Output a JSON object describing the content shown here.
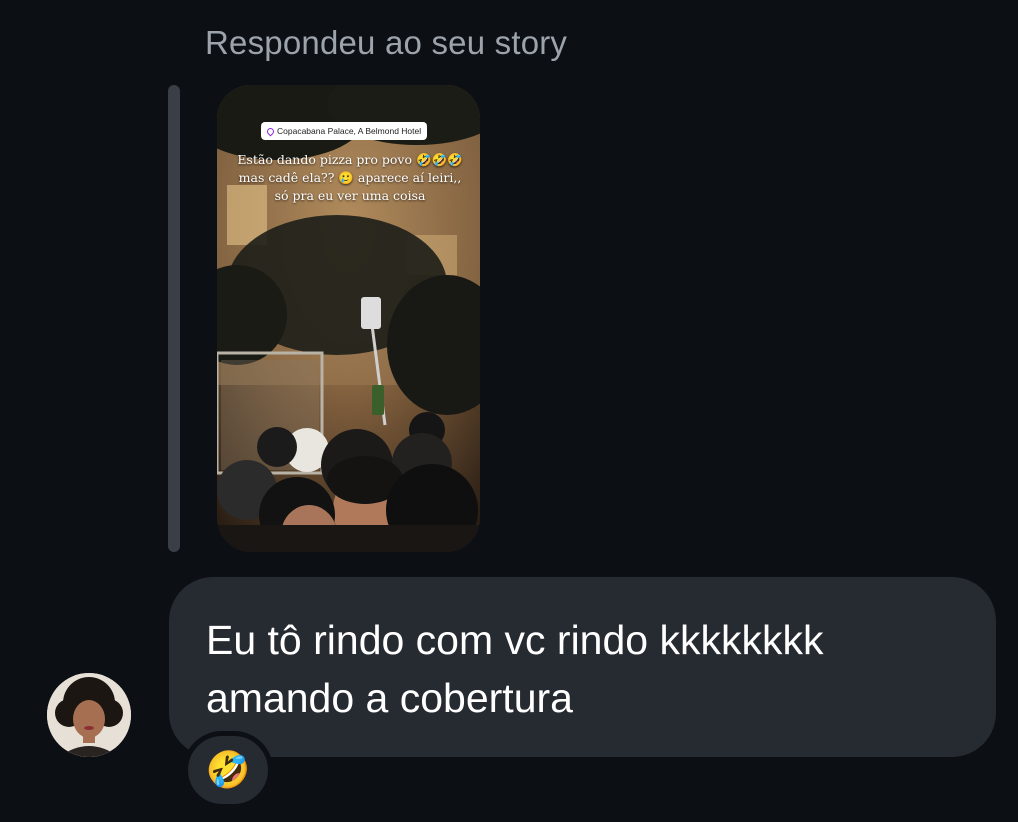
{
  "reply": {
    "caption": "Respondeu ao seu story"
  },
  "story": {
    "location": "Copacabana Palace, A Belmond Hotel",
    "caption": "Estão dando pizza pro povo 🤣🤣🤣 mas cadê ela?? 🥲 aparece aí leiri,, só pra eu ver uma coisa"
  },
  "message": {
    "text": "Eu tô rindo com vc rindo kkkkkkkk amando a cobertura"
  },
  "reaction": {
    "emoji": "🤣"
  },
  "colors": {
    "background": "#0c0f14",
    "bubble": "#262a31",
    "caption_gray": "#9da3ab",
    "quote_bar": "#3a3f47"
  }
}
